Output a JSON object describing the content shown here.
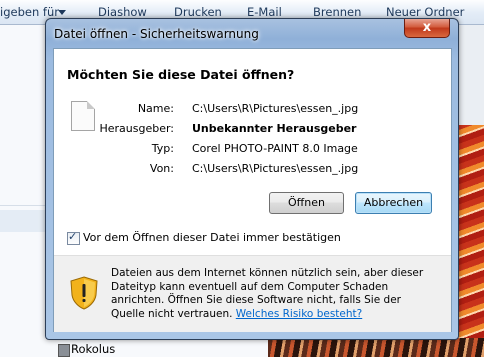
{
  "explorer": {
    "toolbar": {
      "share_label": "igeben für",
      "slideshow_label": "Diashow",
      "print_label": "Drucken",
      "email_label": "E-Mail",
      "burn_label": "Brennen",
      "new_folder_label": "Neuer Ordner"
    },
    "folder_item": "Rokolus"
  },
  "dialog": {
    "title": "Datei öffnen - Sicherheitswarnung",
    "close_glyph": "x",
    "question": "Möchten Sie diese Datei öffnen?",
    "fields": {
      "name_label": "Name:",
      "name_value": "C:\\Users\\R\\Pictures\\essen_.jpg",
      "publisher_label": "Herausgeber:",
      "publisher_value": "Unbekannter Herausgeber",
      "type_label": "Typ:",
      "type_value": "Corel PHOTO-PAINT 8.0 Image",
      "from_label": "Von:",
      "from_value": "C:\\Users\\R\\Pictures\\essen_.jpg"
    },
    "open_button": "Öffnen",
    "cancel_button": "Abbrechen",
    "checkbox": {
      "checked": true,
      "label": "Vor dem Öffnen dieser Datei immer bestätigen"
    },
    "warning": {
      "text": "Dateien aus dem Internet können nützlich sein, aber dieser Dateityp kann eventuell auf dem Computer Schaden anrichten. Öffnen Sie diese Software nicht, falls Sie der Quelle nicht vertrauen.",
      "link": "Welches Risiko besteht?"
    }
  }
}
